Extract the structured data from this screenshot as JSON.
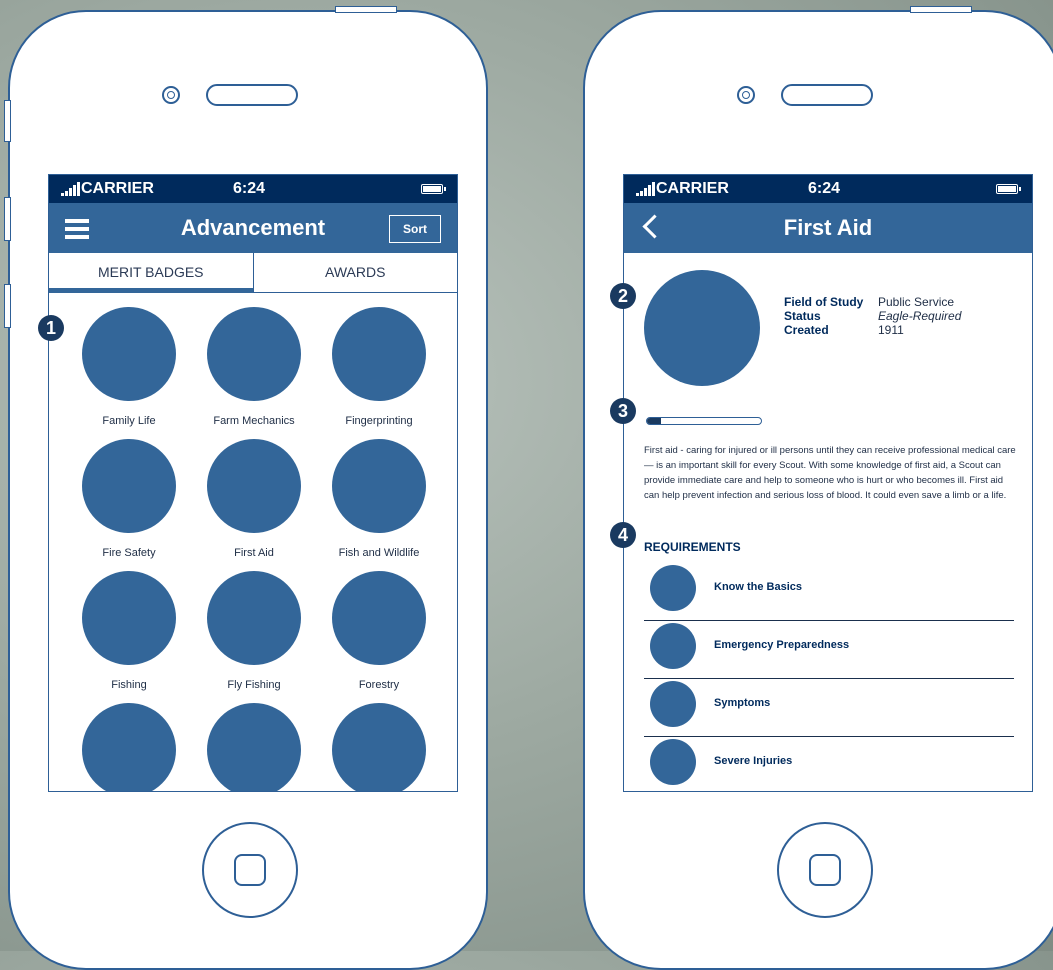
{
  "status_bar": {
    "carrier": "CARRIER",
    "time": "6:24"
  },
  "left_screen": {
    "title": "Advancement",
    "sort_label": "Sort",
    "tabs": [
      {
        "label": "MERIT BADGES",
        "active": true
      },
      {
        "label": "AWARDS",
        "active": false
      }
    ],
    "badges": [
      {
        "label": "Family Life"
      },
      {
        "label": "Farm Mechanics"
      },
      {
        "label": "Fingerprinting"
      },
      {
        "label": "Fire Safety"
      },
      {
        "label": "First Aid"
      },
      {
        "label": "Fish and Wildlife"
      },
      {
        "label": "Fishing"
      },
      {
        "label": "Fly Fishing"
      },
      {
        "label": "Forestry"
      },
      {
        "label": ""
      },
      {
        "label": ""
      },
      {
        "label": ""
      }
    ],
    "marker": "1"
  },
  "right_screen": {
    "title": "First Aid",
    "fields": [
      {
        "key": "Field of Study",
        "value": "Public Service"
      },
      {
        "key": "Status",
        "value": "Eagle-Required"
      },
      {
        "key": "Created",
        "value": "1911"
      }
    ],
    "progress": 0.12,
    "description": "First aid - caring for injured or ill persons until they can receive professional medical care — is an important skill for every Scout. With some knowledge of first aid, a Scout can provide immediate care and help to someone who is hurt or who becomes ill. First aid can help prevent infection and serious loss of blood. It could even save a limb or a life.",
    "requirements_title": "REQUIREMENTS",
    "requirements": [
      {
        "label": "Know the Basics"
      },
      {
        "label": "Emergency Preparedness"
      },
      {
        "label": "Symptoms"
      },
      {
        "label": "Severe Injuries"
      }
    ],
    "markers": [
      "2",
      "3",
      "4"
    ]
  },
  "colors": {
    "primary": "#336699",
    "status_bar": "#002a5c",
    "outline": "#2e5f96"
  }
}
